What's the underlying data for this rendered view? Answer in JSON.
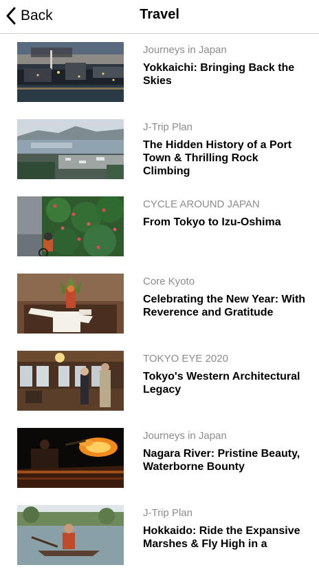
{
  "nav": {
    "back_label": "Back",
    "title": "Travel"
  },
  "items": [
    {
      "series": "Journeys in Japan",
      "title": "Yokkaichi: Bringing Back the Skies"
    },
    {
      "series": "J-Trip Plan",
      "title": "The Hidden History of a Port Town & Thrilling Rock Climbing"
    },
    {
      "series": "CYCLE AROUND JAPAN",
      "title": "From Tokyo to Izu-Oshima"
    },
    {
      "series": "Core Kyoto",
      "title": "Celebrating the New Year: With Reverence and Gratitude"
    },
    {
      "series": "TOKYO EYE 2020",
      "title": "Tokyo's Western Architectural Legacy"
    },
    {
      "series": "Journeys in Japan",
      "title": "Nagara River: Pristine Beauty, Waterborne Bounty"
    },
    {
      "series": "J-Trip Plan",
      "title": "Hokkaido: Ride the Expansive Marshes & Fly High in a"
    }
  ],
  "icons": {
    "back": "chevron-left-icon"
  }
}
